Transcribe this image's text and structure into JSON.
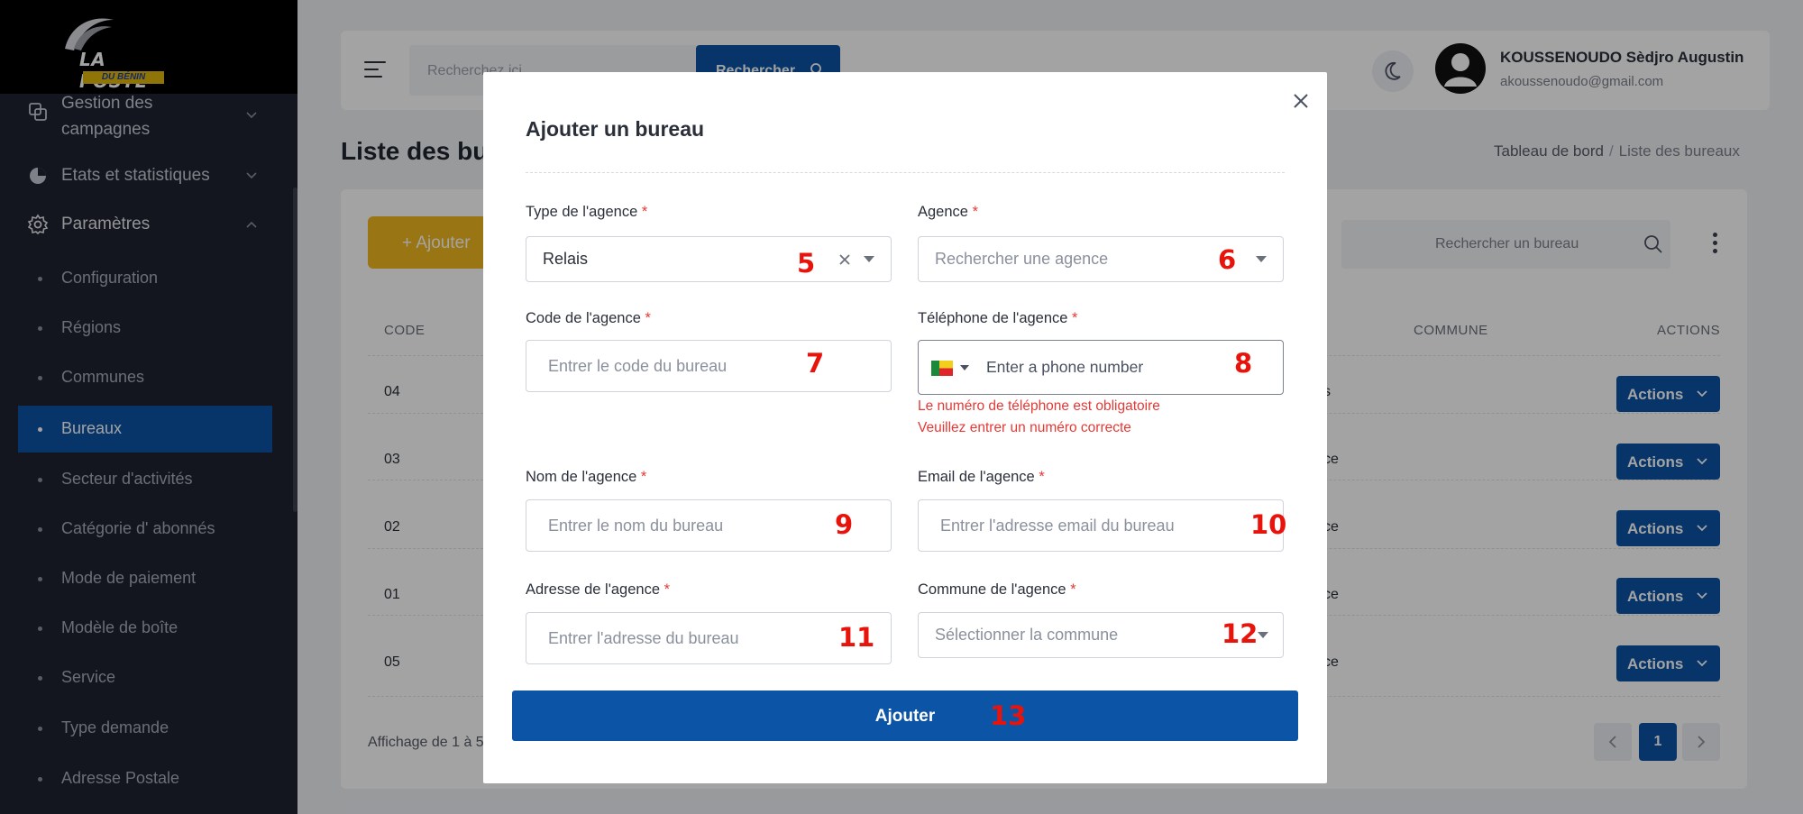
{
  "brand": {
    "logo_main": "LA POSTE",
    "logo_sub": "DU BÉNIN"
  },
  "sidebar": {
    "menu": [
      {
        "label": "Gestion des",
        "label2": "campagnes"
      },
      {
        "label": "Etats et statistiques"
      },
      {
        "label": "Paramètres"
      }
    ],
    "subitems": [
      {
        "label": "Configuration"
      },
      {
        "label": "Régions"
      },
      {
        "label": "Communes"
      },
      {
        "label": "Bureaux",
        "active": true
      },
      {
        "label": "Secteur d'activités"
      },
      {
        "label": "Catégorie d' abonnés"
      },
      {
        "label": "Mode de paiement"
      },
      {
        "label": "Modèle de boîte"
      },
      {
        "label": "Service"
      },
      {
        "label": "Type demande"
      },
      {
        "label": "Adresse Postale"
      }
    ]
  },
  "header": {
    "search_placeholder": "Recherchez ici",
    "search_button": "Rechercher",
    "user_name": "KOUSSENOUDO Sèdjro Augustin",
    "user_email": "akoussenoudo@gmail.com"
  },
  "page": {
    "title": "Liste des bureaux",
    "breadcrumb": [
      "Tableau de bord",
      "/",
      "Liste des bureaux"
    ]
  },
  "table": {
    "add_button": "+ Ajouter",
    "search_placeholder": "Rechercher un bureau",
    "columns": [
      "CODE",
      "COMMUNE",
      "ACTIONS"
    ],
    "rows": [
      {
        "code": "04",
        "commune_suffix": "s",
        "action": "Actions"
      },
      {
        "code": "03",
        "commune_suffix": "ce",
        "action": "Actions"
      },
      {
        "code": "02",
        "commune_suffix": "ce",
        "action": "Actions"
      },
      {
        "code": "01",
        "commune_suffix": "ce",
        "action": "Actions"
      },
      {
        "code": "05",
        "commune_suffix": "ce",
        "action": "Actions"
      }
    ],
    "pagination_info": "Affichage de 1 à 5",
    "current_page": "1"
  },
  "modal": {
    "title": "Ajouter un bureau",
    "fields": {
      "type": {
        "label": "Type de l'agence",
        "value": "Relais",
        "annotation": "5"
      },
      "agence": {
        "label": "Agence",
        "placeholder": "Rechercher une agence",
        "annotation": "6"
      },
      "code": {
        "label": "Code de l'agence",
        "placeholder": "Entrer le code du bureau",
        "annotation": "7"
      },
      "phone": {
        "label": "Téléphone de l'agence",
        "placeholder": "Enter a phone number",
        "annotation": "8",
        "errors": [
          "Le numéro de téléphone est obligatoire",
          "Veuillez entrer un numéro correcte"
        ]
      },
      "nom": {
        "label": "Nom de l'agence",
        "placeholder": "Entrer le nom du bureau",
        "annotation": "9"
      },
      "email": {
        "label": "Email de l'agence",
        "placeholder": "Entrer l'adresse email du bureau",
        "annotation": "10"
      },
      "adresse": {
        "label": "Adresse de l'agence",
        "placeholder": "Entrer l'adresse du bureau",
        "annotation": "11"
      },
      "commune": {
        "label": "Commune de l'agence",
        "placeholder": "Sélectionner la commune",
        "annotation": "12"
      }
    },
    "required_mark": "*",
    "submit": {
      "label": "Ajouter",
      "annotation": "13"
    }
  },
  "colors": {
    "primary": "#0c54a6",
    "accent": "#f1b81e",
    "error": "#e53935",
    "sidebar": "#1e2330",
    "annotation": "#e8140c"
  }
}
